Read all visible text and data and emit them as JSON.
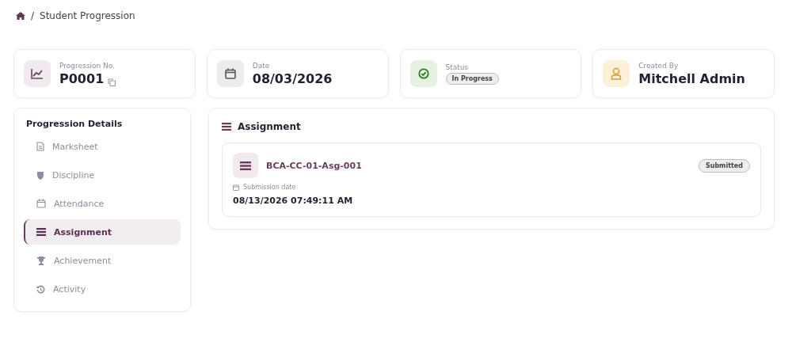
{
  "breadcrumb": {
    "separator": "/",
    "current": "Student Progression"
  },
  "stats": [
    {
      "kind": "value",
      "label": "Progression No.",
      "value": "P0001",
      "copyable": true
    },
    {
      "kind": "value",
      "label": "Date",
      "value": "08/03/2026"
    },
    {
      "kind": "badge",
      "label": "Status",
      "value": "In Progress"
    },
    {
      "kind": "value",
      "label": "Created By",
      "value": "Mitchell Admin"
    }
  ],
  "sidebar": {
    "title": "Progression Details",
    "items": [
      {
        "label": "Marksheet",
        "selected": false
      },
      {
        "label": "Discipline",
        "selected": false
      },
      {
        "label": "Attendance",
        "selected": false
      },
      {
        "label": "Assignment",
        "selected": true
      },
      {
        "label": "Achievement",
        "selected": false
      },
      {
        "label": "Activity",
        "selected": false
      }
    ]
  },
  "panel": {
    "title": "Assignment",
    "items": [
      {
        "name": "BCA-CC-01-Asg-001",
        "status": "Submitted",
        "date_label": "Submission date",
        "date": "08/13/2026 07:49:11 AM"
      }
    ]
  }
}
